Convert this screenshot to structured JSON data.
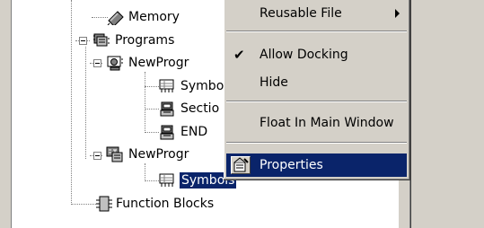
{
  "tree": {
    "items": [
      {
        "label": "Memory",
        "icon": "memory-chip-icon"
      },
      {
        "label": "Programs",
        "icon": "programs-icon"
      },
      {
        "label": "NewProgr",
        "icon": "program-icon"
      },
      {
        "label": "Symbo",
        "icon": "symbols-icon"
      },
      {
        "label": "Sectio",
        "icon": "section-icon"
      },
      {
        "label": "END",
        "icon": "section-icon"
      },
      {
        "label": "NewProgr",
        "icon": "st-program-icon"
      },
      {
        "label": "Symbols",
        "icon": "symbols-icon",
        "selected": true
      },
      {
        "label": "Function Blocks",
        "icon": "function-block-icon"
      }
    ]
  },
  "context_menu": {
    "items": [
      {
        "label": "Reusable File",
        "has_submenu": true
      },
      {
        "label": "Allow Docking",
        "checked": true
      },
      {
        "label": "Hide"
      },
      {
        "label": "Float In Main Window"
      },
      {
        "label": "Properties",
        "highlighted": true,
        "icon": "properties-icon"
      }
    ]
  },
  "colors": {
    "highlight": "#0a246a",
    "face": "#d4d0c8"
  }
}
